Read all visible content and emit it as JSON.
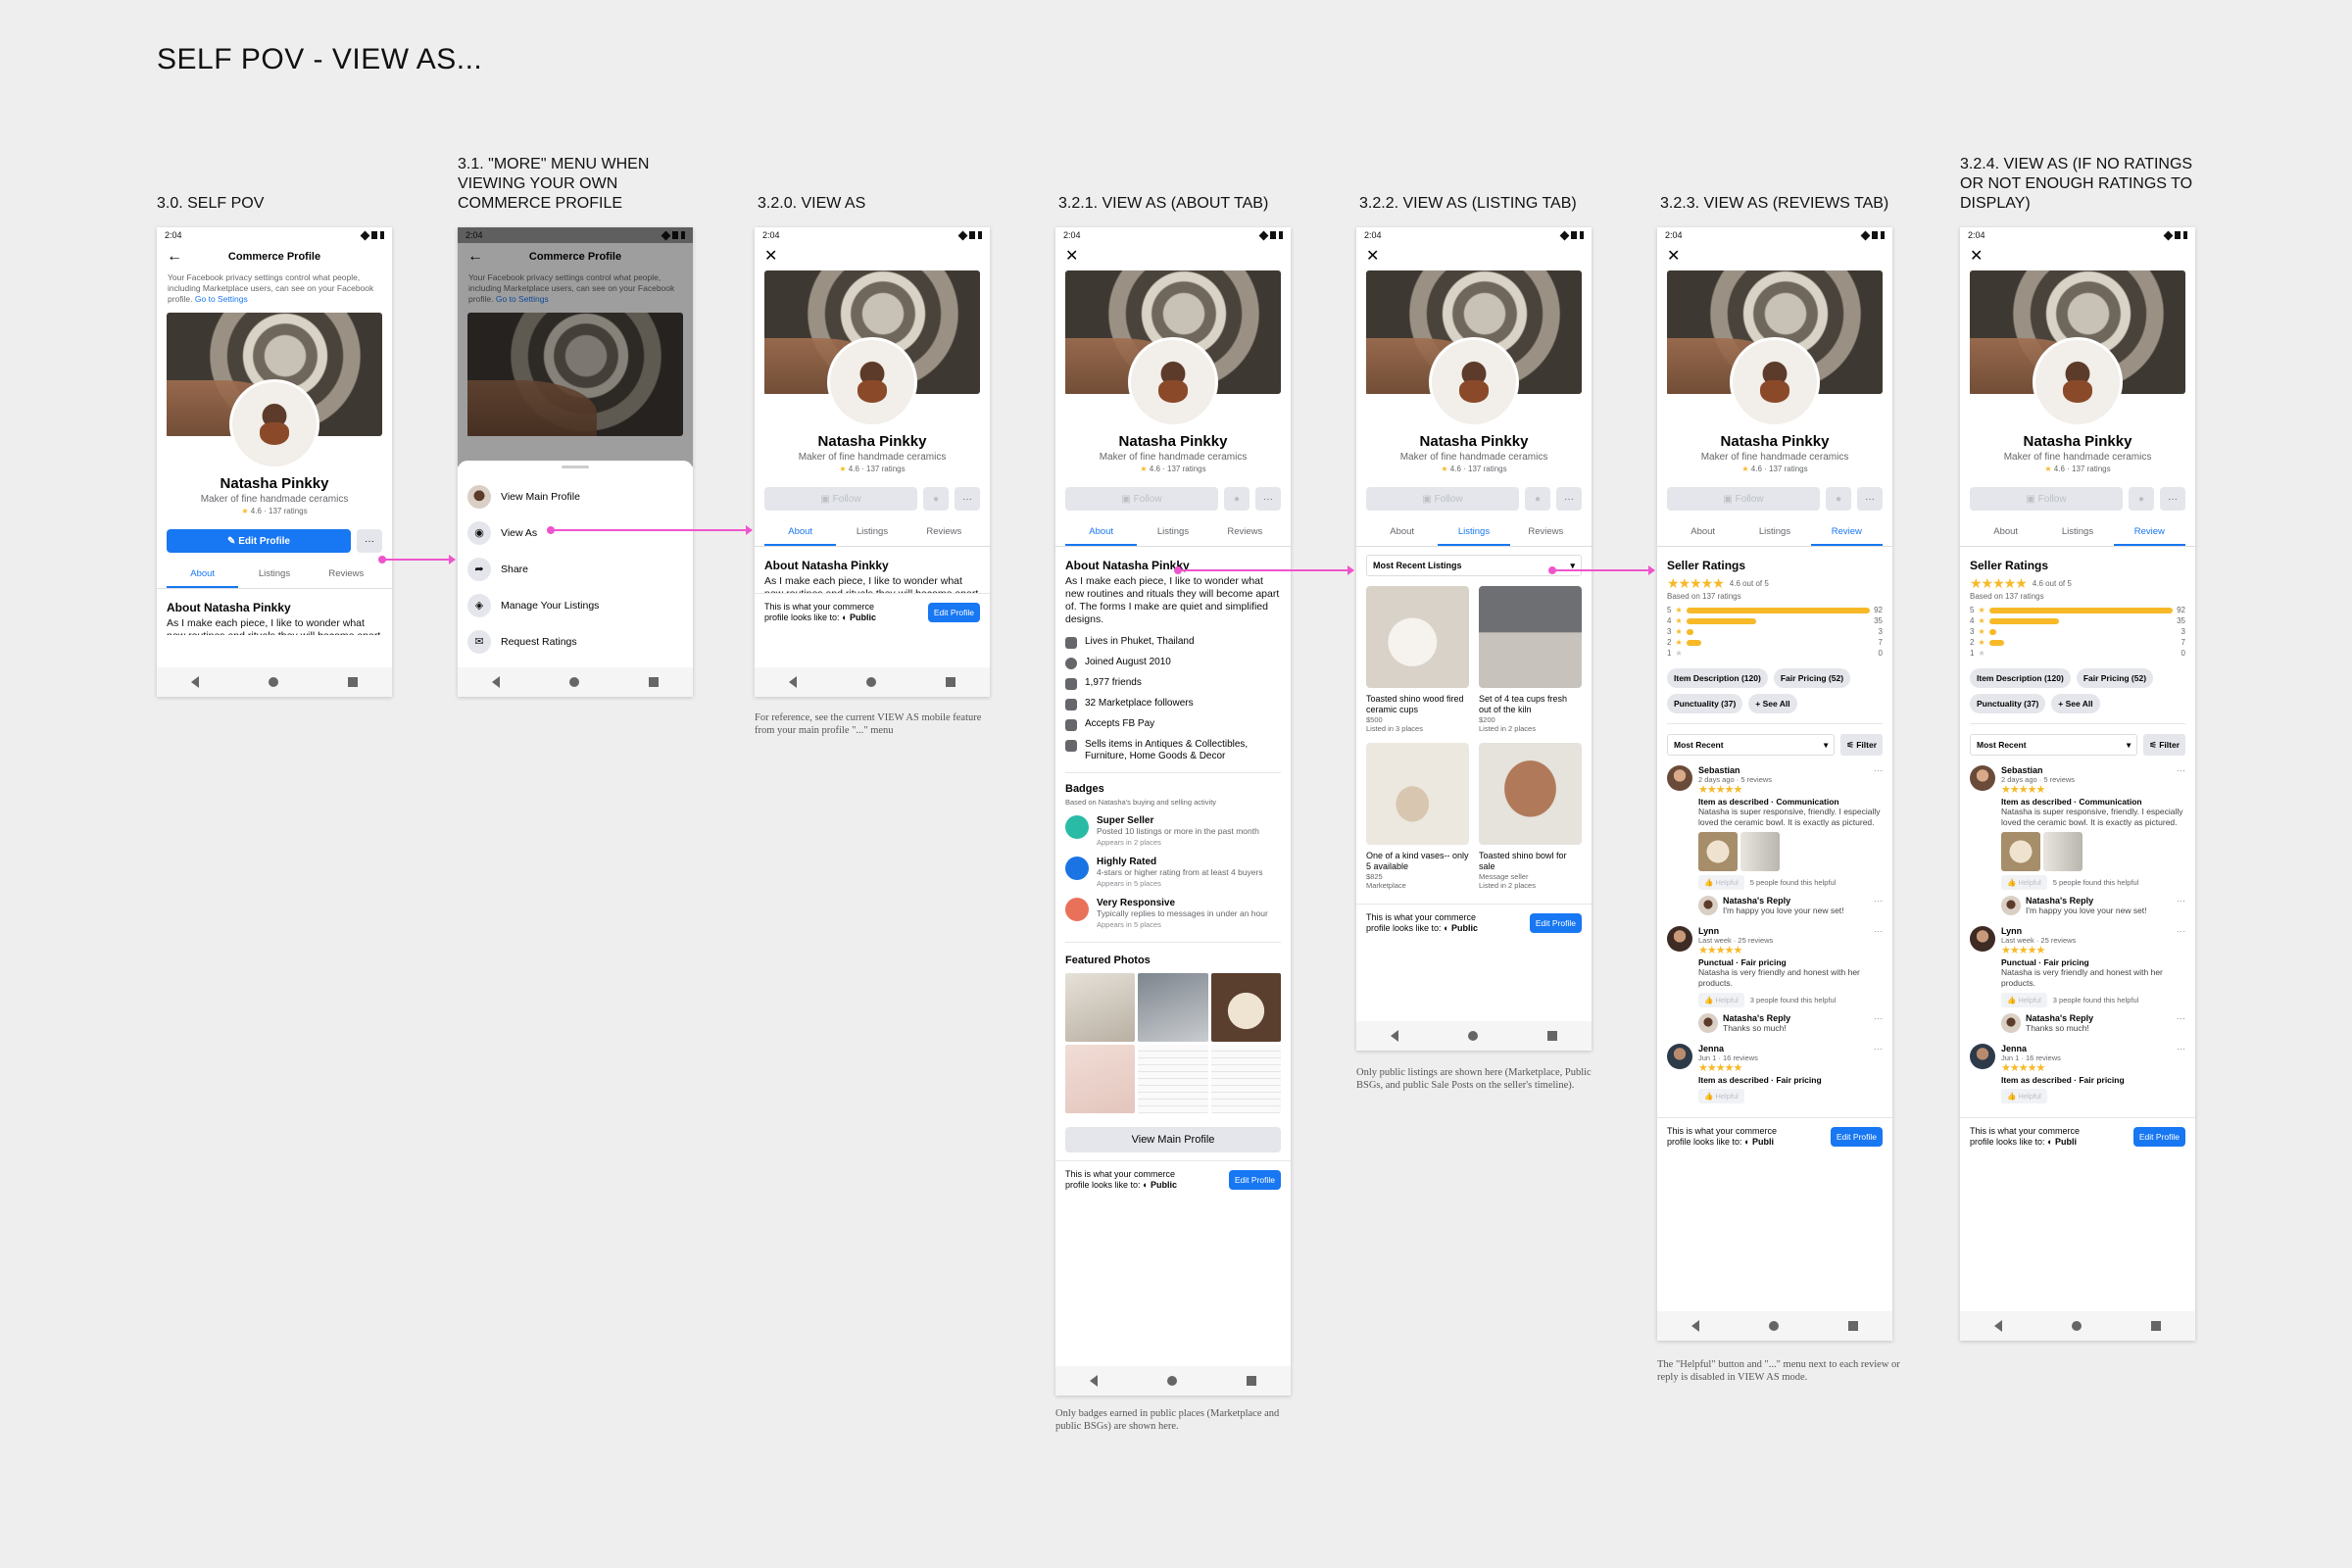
{
  "page_title": "SELF POV - VIEW AS...",
  "labels": {
    "s30": "3.0. SELF POV",
    "s31": "3.1. \"MORE\" MENU WHEN VIEWING YOUR OWN COMMERCE PROFILE",
    "s320": "3.2.0. VIEW AS",
    "s321": "3.2.1. VIEW AS (ABOUT TAB)",
    "s322": "3.2.2. VIEW AS (LISTING TAB)",
    "s323": "3.2.3. VIEW AS (REVIEWS TAB)",
    "s324": "3.2.4. VIEW AS (IF NO RATINGS OR NOT ENOUGH RATINGS TO DISPLAY)"
  },
  "notes": {
    "n320": "For reference, see the current VIEW AS mobile feature from your main profile \"...\" menu",
    "n321": "Only badges earned in public places (Marketplace and public BSGs) are shown here.",
    "n322": "Only public listings are shown here (Marketplace, Public BSGs, and public Sale Posts on the seller's timeline).",
    "n323": "The \"Helpful\" button and \"...\" menu next to each review or reply is disabled in VIEW AS mode."
  },
  "common": {
    "time": "2:04",
    "profile_title": "Commerce Profile",
    "privacy_text": "Your Facebook privacy settings control what people, including Marketplace users, can see on your Facebook profile.",
    "privacy_link": "Go to Settings",
    "name": "Natasha Pinkky",
    "subtitle": "Maker of fine handmade ceramics",
    "ratings": "4.6 · 137 ratings",
    "edit_profile": "Edit Profile",
    "follow": "Follow",
    "more": "···",
    "tab_about": "About",
    "tab_listings": "Listings",
    "tab_reviews": "Reviews",
    "tab_review": "Review",
    "about_heading": "About Natasha Pinkky",
    "about_text": "As I make each piece, I like to wonder what new routines and rituals they will become apart of. The forms I make are quiet and simplified designs.",
    "view_as_line1": "This is what your commerce",
    "view_as_line2": "profile looks like to:",
    "audience": "Public",
    "audience_trunc": "Publi",
    "edit_profile_small": "Edit Profile"
  },
  "menu": [
    {
      "label": "View Main Profile",
      "icon": "avatar"
    },
    {
      "label": "View As",
      "icon": "eye-icon"
    },
    {
      "label": "Share",
      "icon": "share-icon"
    },
    {
      "label": "Manage Your Listings",
      "icon": "tag-icon"
    },
    {
      "label": "Request Ratings",
      "icon": "chat-icon"
    }
  ],
  "about_details": [
    {
      "text": "Lives in Phuket, Thailand",
      "icon": "home-icon"
    },
    {
      "text": "Joined August 2010",
      "icon": "clock-icon"
    },
    {
      "text": "1,977 friends",
      "icon": "friends-icon"
    },
    {
      "text": "32 Marketplace followers",
      "icon": "followers-icon"
    },
    {
      "text": "Accepts FB Pay",
      "icon": "card-icon"
    },
    {
      "text": "Sells items in Antiques & Collectibles, Furniture, Home Goods & Decor",
      "icon": "tag-icon"
    }
  ],
  "badges": {
    "heading": "Badges",
    "sub": "Based on Natasha's buying and selling activity",
    "items": [
      {
        "title": "Super Seller",
        "desc": "Posted 10 listings or more in the past month",
        "appears": "Appears in 2 places",
        "color": "#2abba7"
      },
      {
        "title": "Highly Rated",
        "desc": "4-stars or higher rating from at least 4 buyers",
        "appears": "Appears in 5 places",
        "color": "#1b74e4"
      },
      {
        "title": "Very Responsive",
        "desc": "Typically replies to messages in under an hour",
        "appears": "Appears in 5 places",
        "color": "#e9715a"
      }
    ]
  },
  "featured_photos": "Featured Photos",
  "view_main_profile": "View Main Profile",
  "listings": {
    "sort": "Most Recent Listings",
    "items": [
      {
        "title": "Toasted shino wood fired ceramic cups",
        "price": "$500",
        "where": "Listed in 3 places",
        "color": "#d8d2c8"
      },
      {
        "title": "Set of 4 tea cups fresh out of the kiln",
        "price": "$200",
        "where": "Listed in 2 places",
        "color": "#9a9aa0"
      },
      {
        "title": "One of a kind vases-- only 5 available",
        "price": "$825",
        "where": "Marketplace",
        "color": "#e8e2da"
      },
      {
        "title": "Toasted shino bowl for sale",
        "price": "Message seller",
        "where": "Listed in 2 places",
        "color": "#b07a5a"
      }
    ]
  },
  "reviews": {
    "heading": "Seller Ratings",
    "based_on": "Based on 137 ratings",
    "score": "4.6 out of 5",
    "bars": [
      {
        "label": "5",
        "count": "92",
        "pct": 1.0
      },
      {
        "label": "4",
        "count": "35",
        "pct": 0.38
      },
      {
        "label": "3",
        "count": "3",
        "pct": 0.04
      },
      {
        "label": "2",
        "count": "7",
        "pct": 0.08
      },
      {
        "label": "1",
        "count": "0",
        "pct": 0.0
      }
    ],
    "chips": [
      "Item Description (120)",
      "Fair Pricing (52)",
      "Punctuality (37)",
      "+ See All"
    ],
    "sort": "Most Recent",
    "filter": "Filter",
    "helpful": "Helpful",
    "list": [
      {
        "name": "Sebastian",
        "meta": "2 days ago · 5 reviews",
        "tags": "Item as described · Communication",
        "text": "Natasha is super responsive, friendly. I especially loved the ceramic bowl. It is exactly as pictured.",
        "found": "5 people found this helpful",
        "reply_name": "Natasha's Reply",
        "reply": "I'm happy you love your new set!"
      },
      {
        "name": "Lynn",
        "meta": "Last week · 25 reviews",
        "tags": "Punctual · Fair pricing",
        "text": "Natasha is very friendly and honest with her products.",
        "found": "3 people found this helpful",
        "reply_name": "Natasha's Reply",
        "reply": "Thanks so much!"
      },
      {
        "name": "Jenna",
        "meta": "Jun 1 · 16 reviews",
        "tags": "Item as described · Fair pricing",
        "text": "",
        "found": "",
        "reply_name": "",
        "reply": ""
      }
    ]
  }
}
